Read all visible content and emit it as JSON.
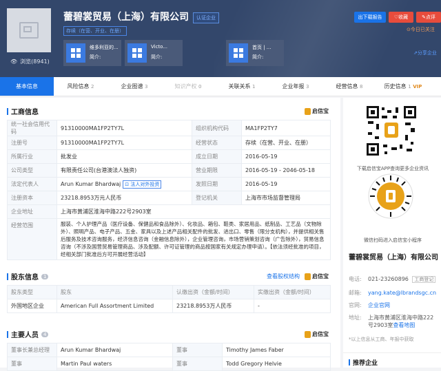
{
  "company": {
    "name": "蕾碧裳贸易（上海）有限公司",
    "certified": "认证企业",
    "status": "存续（在营、开业、在册）",
    "views": "浏览(8941)"
  },
  "cards": [
    {
      "name": "维多利亚的...",
      "sub": "简介:"
    },
    {
      "name": "Victo...",
      "sub": "简介:"
    },
    {
      "name": "首页 | ...",
      "sub": "简介:"
    }
  ],
  "actions": {
    "report": "出下载报告",
    "favorite": "收藏",
    "comment": "点评",
    "follow": "今日已关注",
    "share": "分享企业"
  },
  "tabs": [
    {
      "label": "基本信息",
      "count": ""
    },
    {
      "label": "风险信息",
      "count": "2"
    },
    {
      "label": "企业图谱",
      "count": "3"
    },
    {
      "label": "知识产权",
      "count": "0"
    },
    {
      "label": "关联关系",
      "count": "1"
    },
    {
      "label": "企业年报",
      "count": "3"
    },
    {
      "label": "经营信息",
      "count": "8"
    },
    {
      "label": "历史信息",
      "count": "1",
      "vip": "VIP"
    }
  ],
  "biz": {
    "title": "工商信息",
    "brand": "启信宝",
    "rows": [
      [
        "统一社会信用代码",
        "91310000MA1FP2TY7L",
        "组织机构代码",
        "MA1FP2TY7"
      ],
      [
        "注册号",
        "91310000MA1FP2TY7L",
        "经营状态",
        "存续（在营、开业、在册）"
      ],
      [
        "所属行业",
        "批发业",
        "成立日期",
        "2016-05-19"
      ],
      [
        "公司类型",
        "有限责任公司(台港澳法人独资)",
        "营业期限",
        "2016-05-19 - 2046-05-18"
      ],
      [
        "法定代表人",
        "Arun Kumar Bhardwaj",
        "发照日期",
        "2016-05-19"
      ],
      [
        "注册资本",
        "23218.8953万元人民币",
        "登记机关",
        "上海市市场监督管理局"
      ]
    ],
    "legal_tag": "法人对外投资",
    "address_label": "企业地址",
    "address": "上海市黄浦区淮海中路222号2903室",
    "scope_label": "经营范围",
    "scope": "服装、个人护理产品（医疗设备、保健品和食品除外）、化妆品、箱包、鞋类、家居用品、纸制品、工艺品（文物除外）、照明产品、电子产品、五金、家具以及上述产品相关配件的批发、进出口、零售（限分支机构），并提供相关售后服务及技术咨询服务，经济信息咨询（金融信息除外），企业管理咨询，市场营销策划咨询（广告除外），贸易信息咨询（不涉及国营贸易管理商品、涉及配额、许可证管理的商品按国家有关规定办理申请）。【依法须经批准的项目，经相关部门批准后方可开展经营活动】"
  },
  "shareholders": {
    "title": "股东信息",
    "count": "1",
    "link": "查看股权结构",
    "brand": "启信宝",
    "headers": [
      "股东类型",
      "股东",
      "认缴出资（金额/时间）",
      "实缴出资（金额/时间）"
    ],
    "rows": [
      [
        "外国地区企业",
        "American Full Assortment Limited",
        "23218.8953万人民币",
        "-"
      ]
    ]
  },
  "people": {
    "title": "主要人员",
    "count": "4",
    "brand": "启信宝",
    "rows": [
      [
        "董事长兼总经理",
        "Arun Kumar Bhardwaj",
        "董事",
        "Timothy James Faber"
      ],
      [
        "董事",
        "Martin Paul waters",
        "董事",
        "Todd Gregory Helvie"
      ]
    ]
  },
  "side": {
    "app_text": "下载启信宝APP查询更多企业资讯",
    "mini_text": "微信扫码进入启信宝小程序",
    "name": "蕾碧裳贸易（上海）有限公司",
    "phone_label": "电话:",
    "phone": "021-23260896",
    "phone_tag": "工商登记",
    "email_label": "邮箱:",
    "email": "yang.kate@lbrandsgc.cn",
    "web_label": "官网:",
    "web": "企业官网",
    "addr_label": "地址:",
    "addr": "上海市黄浦区淮海中路222号2903室",
    "addr_link": "查看地图",
    "note": "*以上信息从工商、年报中获取",
    "rec": "推荐企业"
  }
}
